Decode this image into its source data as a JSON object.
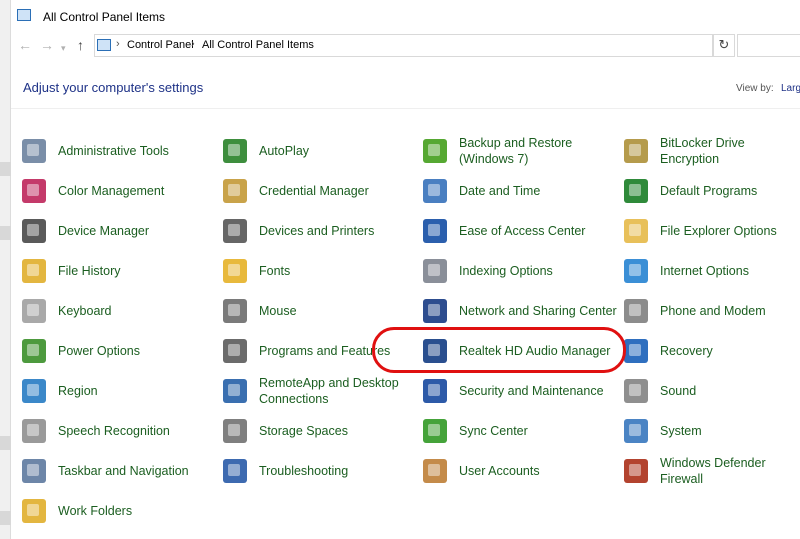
{
  "window": {
    "title": "All Control Panel Items"
  },
  "address": {
    "crumbs": [
      "Control Panel",
      "All Control Panel Items"
    ]
  },
  "header": {
    "title": "Adjust your computer's settings",
    "view_by_label": "View by:",
    "view_by_value": "Larg"
  },
  "items": [
    {
      "label": "Administrative Tools",
      "icon": "admin-tools-icon",
      "color": "#7a8ea8"
    },
    {
      "label": "AutoPlay",
      "icon": "autoplay-icon",
      "color": "#3e8e3e"
    },
    {
      "label": "Backup and Restore (Windows 7)",
      "icon": "backup-icon",
      "color": "#56a832"
    },
    {
      "label": "BitLocker Drive Encryption",
      "icon": "bitlocker-icon",
      "color": "#b59b4c"
    },
    {
      "label": "Color Management",
      "icon": "color-management-icon",
      "color": "#c43a6a"
    },
    {
      "label": "Credential Manager",
      "icon": "credential-manager-icon",
      "color": "#c9a34a"
    },
    {
      "label": "Date and Time",
      "icon": "date-time-icon",
      "color": "#4a7fc1"
    },
    {
      "label": "Default Programs",
      "icon": "default-programs-icon",
      "color": "#2f8a3a"
    },
    {
      "label": "Device Manager",
      "icon": "device-manager-icon",
      "color": "#5a5a5a"
    },
    {
      "label": "Devices and Printers",
      "icon": "printer-icon",
      "color": "#666666"
    },
    {
      "label": "Ease of Access Center",
      "icon": "ease-of-access-icon",
      "color": "#2b5fad"
    },
    {
      "label": "File Explorer Options",
      "icon": "folder-options-icon",
      "color": "#e8c05a"
    },
    {
      "label": "File History",
      "icon": "file-history-icon",
      "color": "#e3b640"
    },
    {
      "label": "Fonts",
      "icon": "fonts-icon",
      "color": "#e8b93c"
    },
    {
      "label": "Indexing Options",
      "icon": "indexing-icon",
      "color": "#8a8f99"
    },
    {
      "label": "Internet Options",
      "icon": "internet-options-icon",
      "color": "#3b8fd6"
    },
    {
      "label": "Keyboard",
      "icon": "keyboard-icon",
      "color": "#a9a9a9"
    },
    {
      "label": "Mouse",
      "icon": "mouse-icon",
      "color": "#7a7a7a"
    },
    {
      "label": "Network and Sharing Center",
      "icon": "network-icon",
      "color": "#2d4d8f"
    },
    {
      "label": "Phone and Modem",
      "icon": "phone-icon",
      "color": "#8c8c8c"
    },
    {
      "label": "Power Options",
      "icon": "power-options-icon",
      "color": "#4d9a3e"
    },
    {
      "label": "Programs and Features",
      "icon": "programs-features-icon",
      "color": "#6b6b6b"
    },
    {
      "label": "Realtek HD Audio Manager",
      "icon": "realtek-audio-icon",
      "color": "#2a4f8f"
    },
    {
      "label": "Recovery",
      "icon": "recovery-icon",
      "color": "#2f6fbf"
    },
    {
      "label": "Region",
      "icon": "region-icon",
      "color": "#3b88c9"
    },
    {
      "label": "RemoteApp and Desktop Connections",
      "icon": "remoteapp-icon",
      "color": "#3a6fb0"
    },
    {
      "label": "Security and Maintenance",
      "icon": "security-flag-icon",
      "color": "#2d5aa8"
    },
    {
      "label": "Sound",
      "icon": "sound-icon",
      "color": "#8f8f8f"
    },
    {
      "label": "Speech Recognition",
      "icon": "microphone-icon",
      "color": "#9a9a9a"
    },
    {
      "label": "Storage Spaces",
      "icon": "storage-spaces-icon",
      "color": "#7f7f7f"
    },
    {
      "label": "Sync Center",
      "icon": "sync-center-icon",
      "color": "#45a33a"
    },
    {
      "label": "System",
      "icon": "system-icon",
      "color": "#4b84c4"
    },
    {
      "label": "Taskbar and Navigation",
      "icon": "taskbar-icon",
      "color": "#6d86a8"
    },
    {
      "label": "Troubleshooting",
      "icon": "troubleshooting-icon",
      "color": "#3d6ab0"
    },
    {
      "label": "User Accounts",
      "icon": "user-accounts-icon",
      "color": "#c48b4a"
    },
    {
      "label": "Windows Defender Firewall",
      "icon": "firewall-icon",
      "color": "#b3432f"
    },
    {
      "label": "Work Folders",
      "icon": "work-folders-icon",
      "color": "#e3b640"
    }
  ]
}
